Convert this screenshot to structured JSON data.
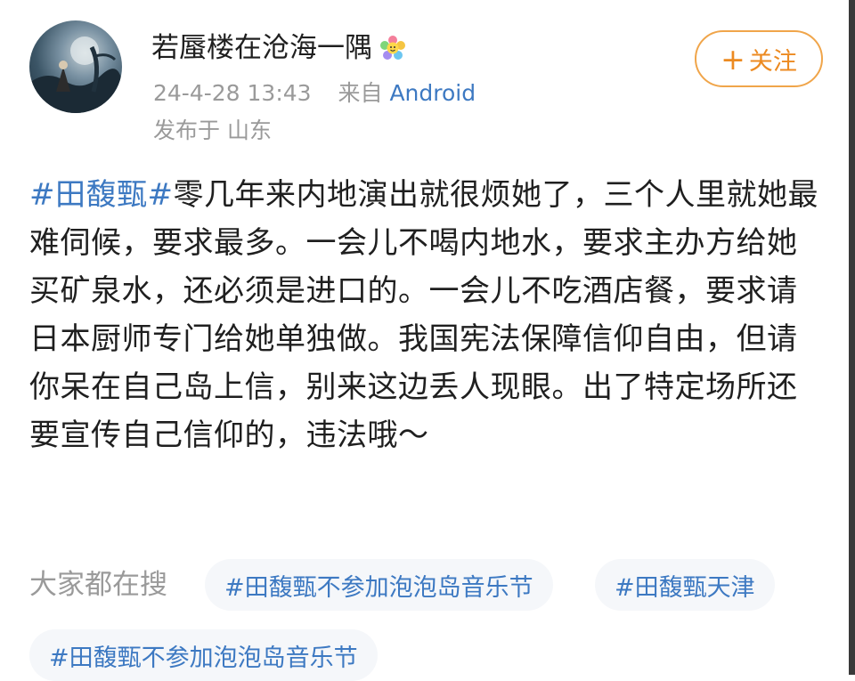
{
  "post": {
    "author": "若蜃楼在沧海一隅",
    "timestamp": "24-4-28 13:43",
    "from_prefix": "来自",
    "source": "Android",
    "location": "发布于 山东",
    "follow_label": "关注",
    "follow_plus": "+",
    "hashtag": "#田馥甄#",
    "text": "零几年来内地演出就很烦她了，三个人里就她最难伺候，要求最多。一会儿不喝内地水，要求主办方给她买矿泉水，还必须是进口的。一会儿不吃酒店餐，要求请日本厨师专门给她单独做。我国宪法保障信仰自由，但请你呆在自己岛上信，别来这边丢人现眼。出了特定场所还要宣传自己信仰的，违法哦～"
  },
  "trending": {
    "label": "大家都在搜",
    "chips": [
      "#田馥甄不参加泡泡岛音乐节",
      "#田馥甄天津",
      "#田馥甄不参加泡泡岛音乐节"
    ]
  },
  "colors": {
    "link_blue": "#3d79c2",
    "follow_orange": "#ec8a21",
    "meta_gray": "#9a9a9a"
  },
  "icons": {
    "author_badge": "flower-badge-icon"
  }
}
